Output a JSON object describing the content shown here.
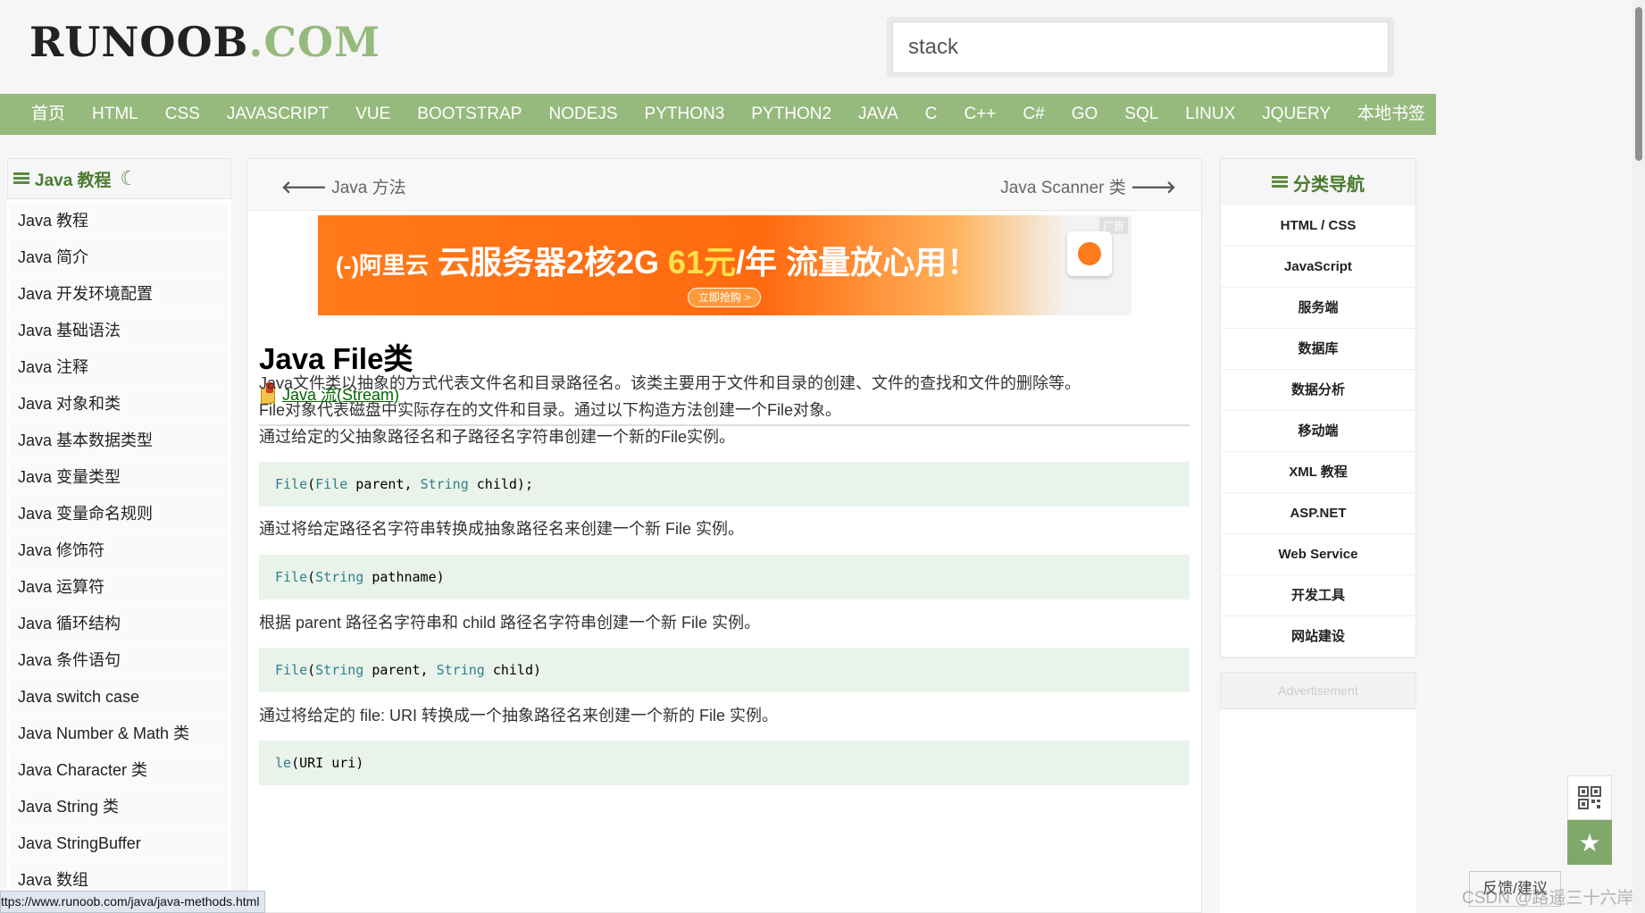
{
  "header": {
    "logo_main": "RUNOOB",
    "logo_suffix": ".COM",
    "search_value": "stack"
  },
  "navbar": {
    "items": [
      "首页",
      "HTML",
      "CSS",
      "JAVASCRIPT",
      "VUE",
      "BOOTSTRAP",
      "NODEJS",
      "PYTHON3",
      "PYTHON2",
      "JAVA",
      "C",
      "C++",
      "C#",
      "GO",
      "SQL",
      "LINUX",
      "JQUERY",
      "本地书签"
    ]
  },
  "left_sidebar": {
    "title": "Java 教程",
    "items": [
      "Java 教程",
      "Java 简介",
      "Java 开发环境配置",
      "Java 基础语法",
      "Java 注释",
      "Java 对象和类",
      "Java 基本数据类型",
      "Java 变量类型",
      "Java 变量命名规则",
      "Java 修饰符",
      "Java 运算符",
      "Java 循环结构",
      "Java 条件语句",
      "Java switch case",
      "Java Number & Math 类",
      "Java Character 类",
      "Java String 类",
      "Java StringBuffer",
      "Java 数组"
    ]
  },
  "main": {
    "prev_label": "Java 方法",
    "next_label": "Java Scanner 类",
    "ad": {
      "brand": "(-)阿里云",
      "text_a": " 云服务器2核2G ",
      "text_b": "61元",
      "text_c": "/年 流量放心用！",
      "button": "立即抢购 >",
      "tag": "广告"
    },
    "title": "Java File类",
    "category_link": "Java 流(Stream)",
    "paragraphs": [
      "Java文件类以抽象的方式代表文件名和目录路径名。该类主要用于文件和目录的创建、文件的查找和文件的删除等。",
      "File对象代表磁盘中实际存在的文件和目录。通过以下构造方法创建一个File对象。",
      "通过给定的父抽象路径名和子路径名字符串创建一个新的File实例。"
    ],
    "code_blocks": [
      {
        "name": "File",
        "p1t": "File",
        "p1": " parent, ",
        "p2t": "String",
        "p2": " child);",
        "full": "File(File parent, String child);"
      },
      {
        "name": "File",
        "p1t": "String",
        "p1": " pathname)",
        "p2t": "",
        "p2": ""
      },
      {
        "name": "File",
        "p1t": "String",
        "p1": " parent, ",
        "p2t": "String",
        "p2": " child)"
      },
      {
        "name": "le",
        "p1t": "",
        "p1": "(URI uri)",
        "p2t": "",
        "p2": ""
      }
    ],
    "desc_2": "通过将给定路径名字符串转换成抽象路径名来创建一个新 File 实例。",
    "desc_3": "根据 parent 路径名字符串和 child 路径名字符串创建一个新 File 实例。",
    "desc_4": "通过将给定的 file: URI 转换成一个抽象路径名来创建一个新的 File 实例。"
  },
  "right_sidebar": {
    "title": "分类导航",
    "items": [
      "HTML / CSS",
      "JavaScript",
      "服务端",
      "数据库",
      "数据分析",
      "移动端",
      "XML 教程",
      "ASP.NET",
      "Web Service",
      "开发工具",
      "网站建设"
    ],
    "advertisement": "Advertisement"
  },
  "floating": {
    "feedback": "反馈/建议",
    "watermark": "CSDN @路遥三十六岸"
  },
  "status_url": "ttps://www.runoob.com/java/java-methods.html",
  "colors": {
    "accent_green": "#96b97d",
    "code_bg": "#e9f3ea",
    "link_green": "#006600"
  }
}
